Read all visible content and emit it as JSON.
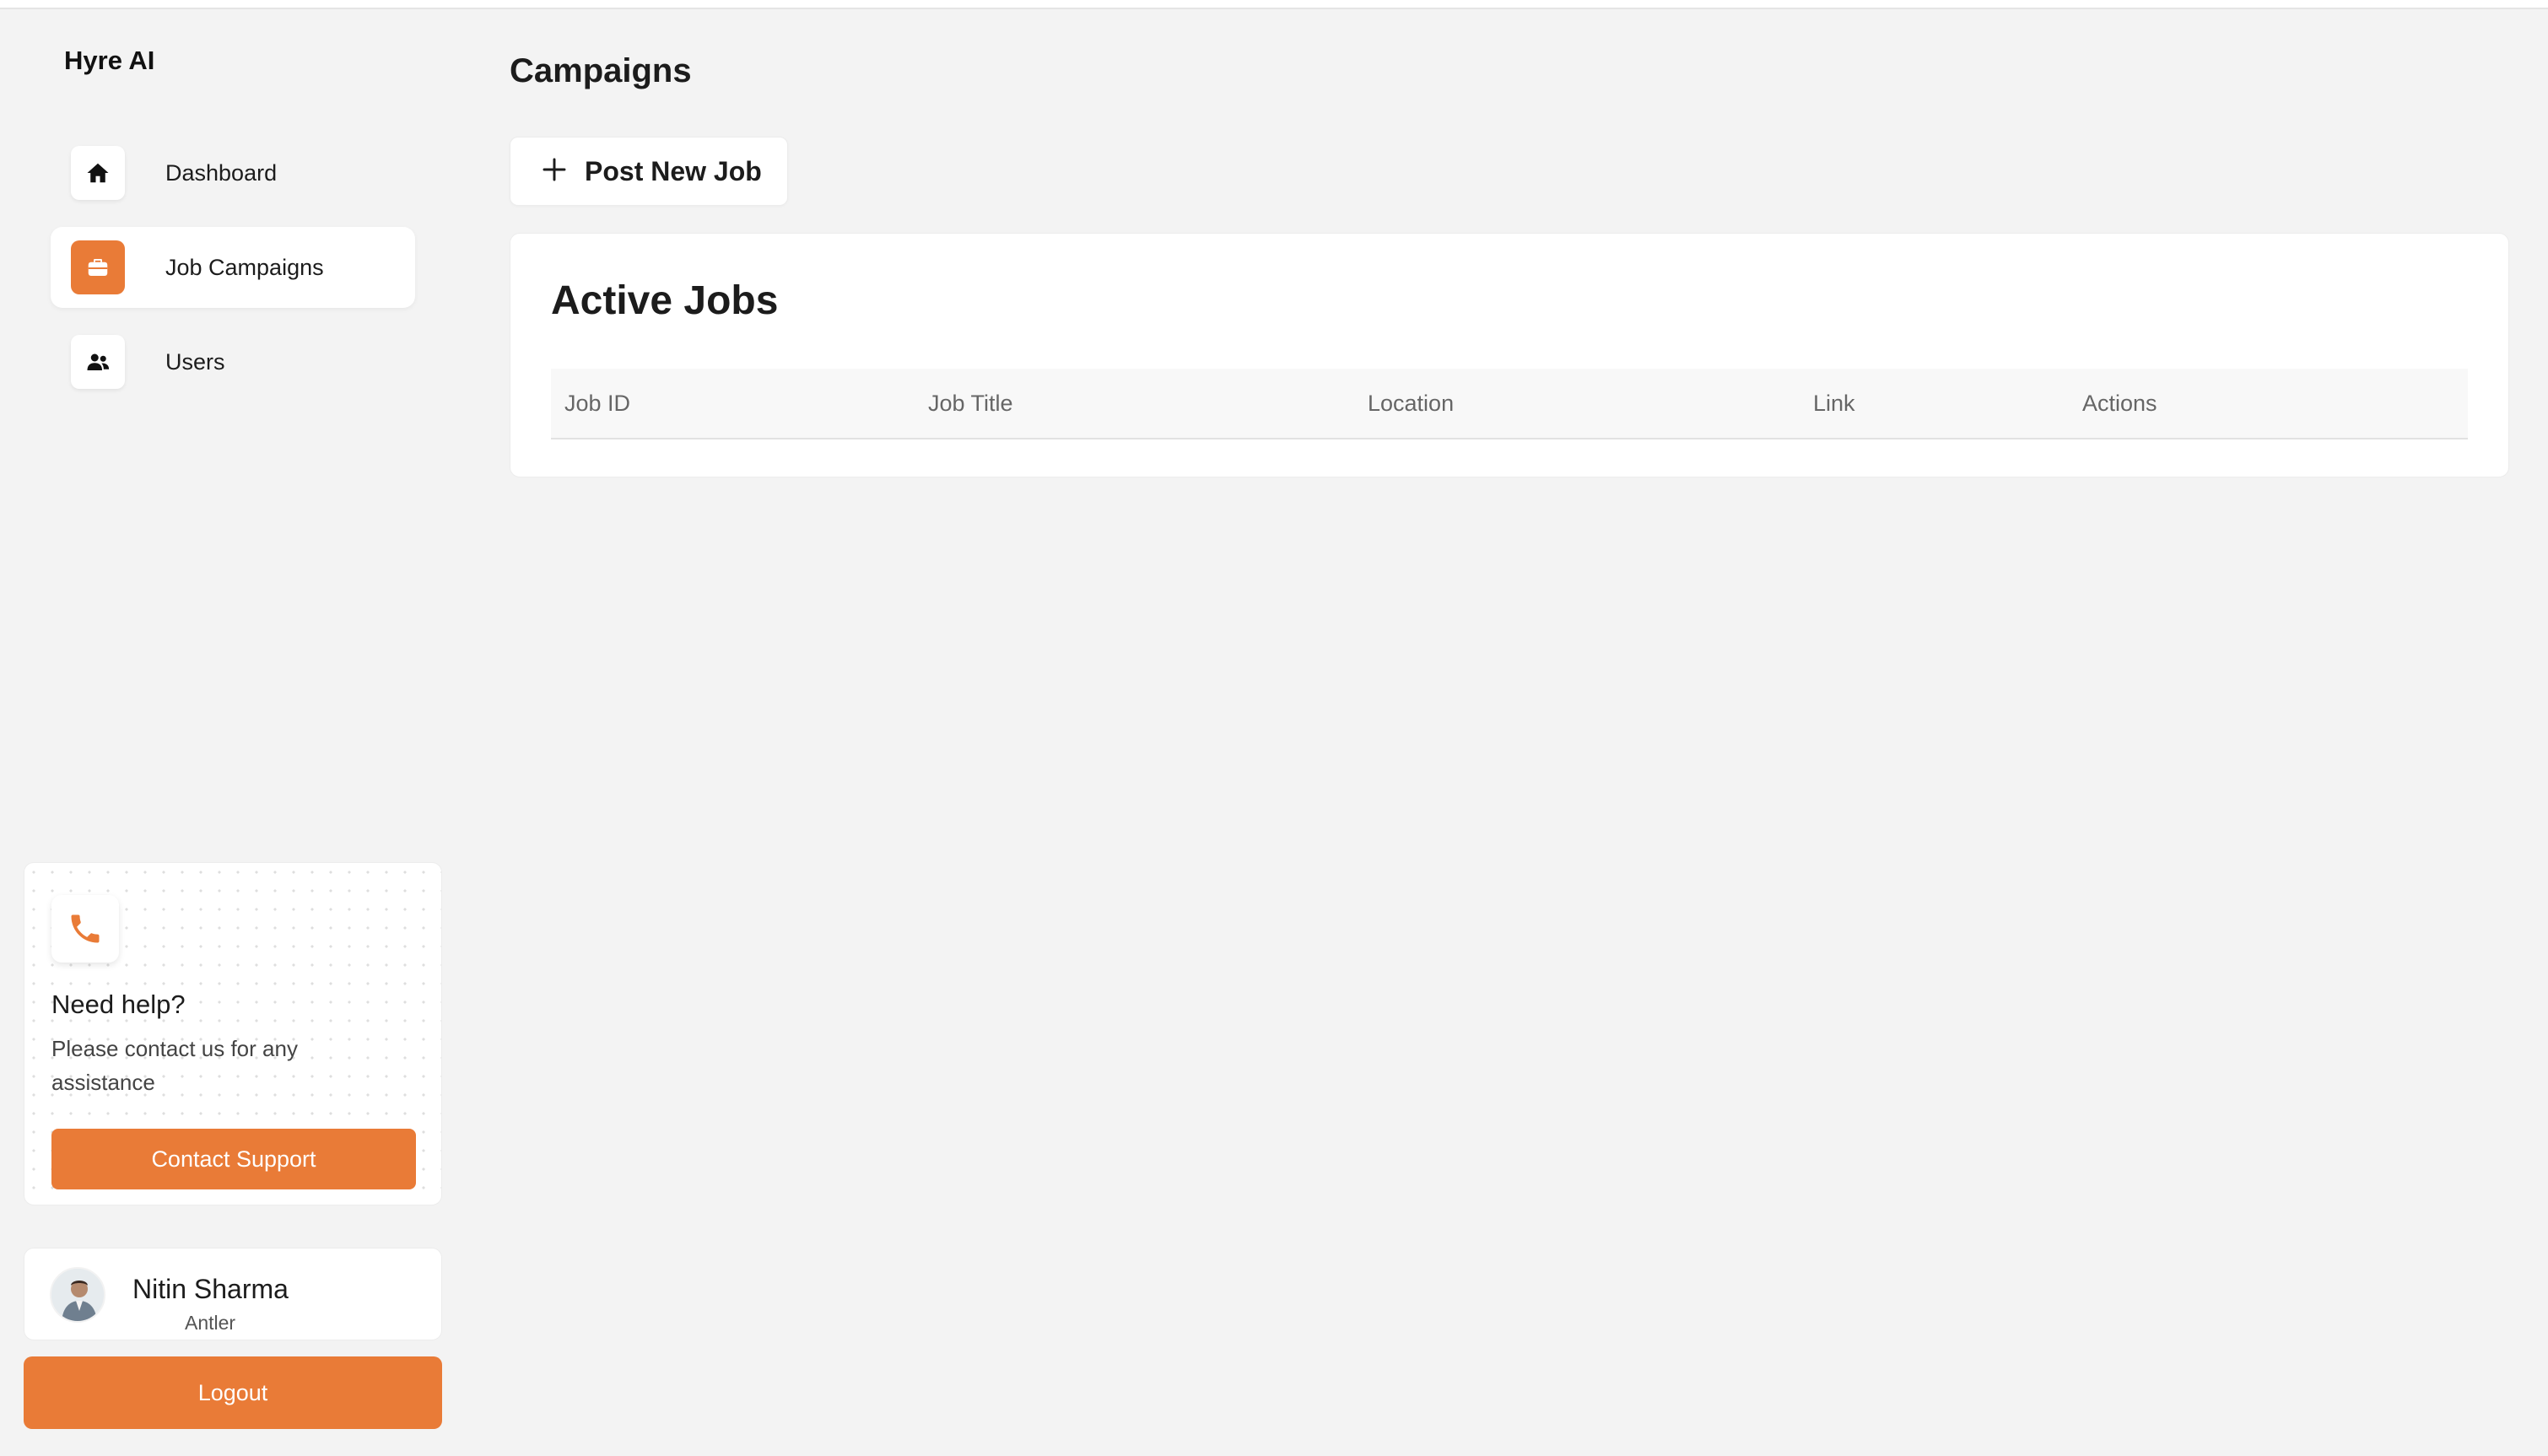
{
  "sidebar": {
    "brand": "Hyre AI",
    "nav": [
      {
        "label": "Dashboard",
        "icon": "home-icon",
        "active": false
      },
      {
        "label": "Job Campaigns",
        "icon": "briefcase-icon",
        "active": true
      },
      {
        "label": "Users",
        "icon": "users-icon",
        "active": false
      }
    ],
    "help": {
      "icon": "phone-icon",
      "title": "Need help?",
      "text": "Please contact us for any assistance",
      "button": "Contact Support"
    },
    "user": {
      "name": "Nitin Sharma",
      "org": "Antler",
      "avatar_icon": "avatar"
    },
    "logout": "Logout"
  },
  "main": {
    "title": "Campaigns",
    "post_button": {
      "label": "Post New Job",
      "icon": "plus-icon"
    },
    "active_jobs": {
      "title": "Active Jobs",
      "columns": [
        "Job ID",
        "Job Title",
        "Location",
        "Link",
        "Actions"
      ],
      "rows": []
    }
  },
  "colors": {
    "accent": "#e97b37",
    "background": "#f3f3f3",
    "card": "#ffffff"
  }
}
